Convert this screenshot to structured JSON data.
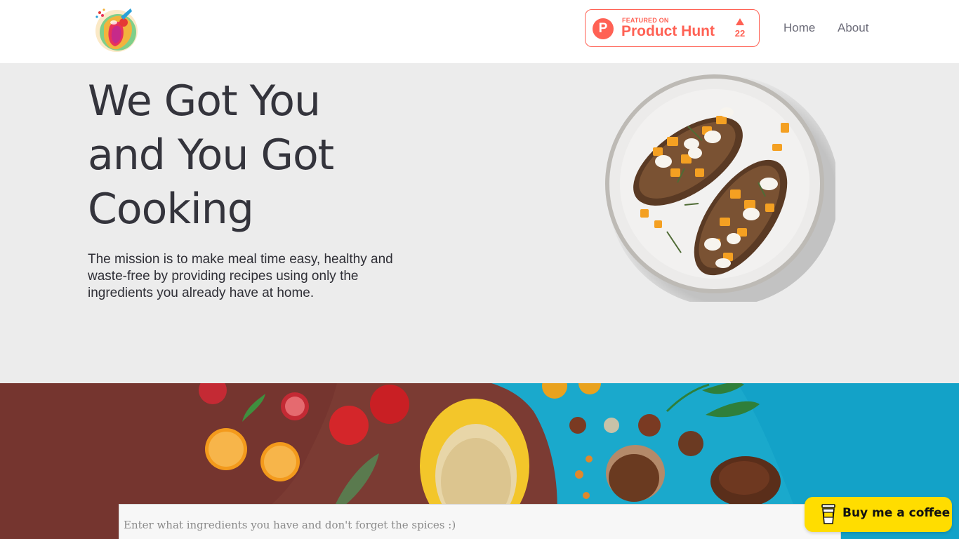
{
  "header": {
    "product_hunt": {
      "badge_letter": "P",
      "featured_label": "FEATURED ON",
      "name": "Product Hunt",
      "upvotes": "22"
    },
    "nav": [
      {
        "label": "Home"
      },
      {
        "label": "About"
      }
    ]
  },
  "hero": {
    "title": "We Got You\nand You Got\nCooking",
    "description": "The mission is to make meal time easy, healthy and waste-free by providing recipes using only the ingredients you already have at home."
  },
  "search": {
    "placeholder": "Enter what ingredients you have and don't forget the spices :)",
    "value": ""
  },
  "coffee_button": {
    "label": "Buy me a coffee"
  },
  "colors": {
    "product_hunt_accent": "#ff6154",
    "coffee_yellow": "#ffdd00",
    "hero_background": "#ececec",
    "banner_brown": "#7b3b33",
    "banner_blue": "#1aa9cc"
  },
  "icons": {
    "logo": "colorful-food-logo",
    "upvote": "triangle-up-icon",
    "coffee": "coffee-cup-icon"
  }
}
